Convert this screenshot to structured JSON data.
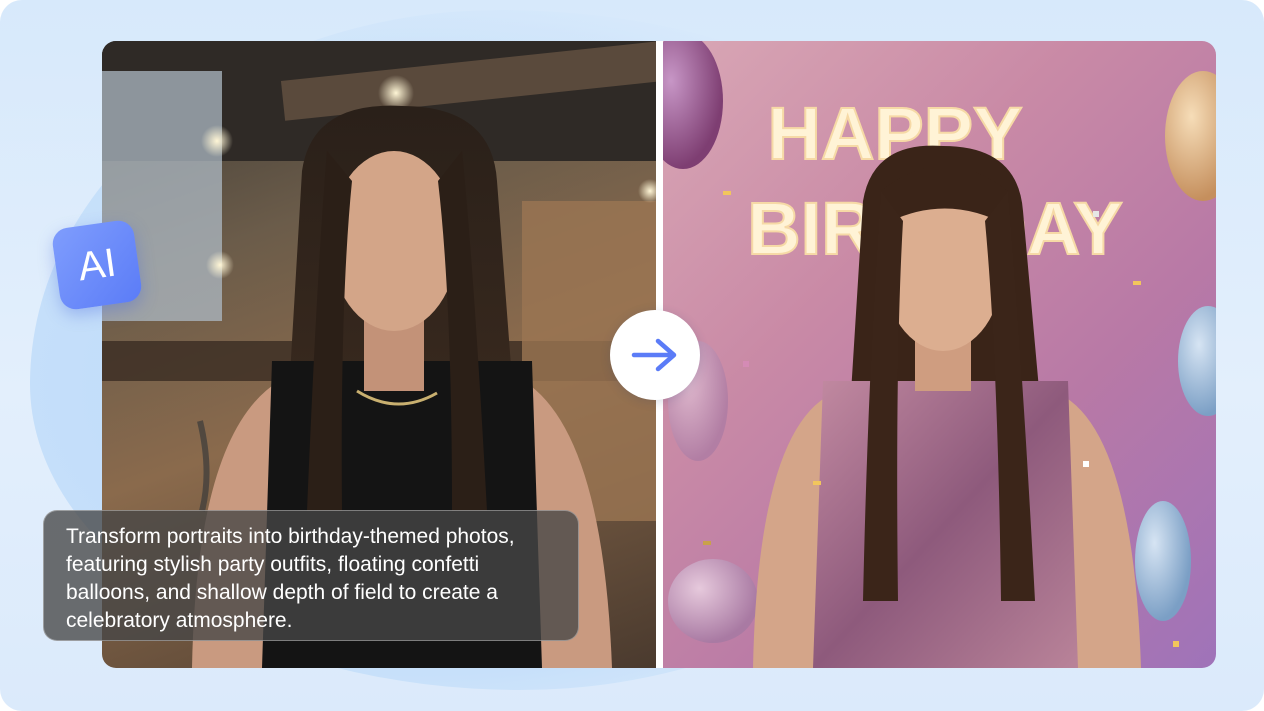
{
  "badge": {
    "label": "AI"
  },
  "caption": {
    "text": "Transform portraits into birthday-themed photos, featuring stylish party outfits, floating confetti balloons, and shallow depth of field to create a celebratory atmosphere."
  },
  "after_photo": {
    "sign_line1": "HAPPY",
    "sign_line2": "BIRTHDAY"
  },
  "icons": {
    "transform": "arrow-right-icon"
  },
  "colors": {
    "accent": "#5b7cf7",
    "background": "#dbeafb"
  }
}
